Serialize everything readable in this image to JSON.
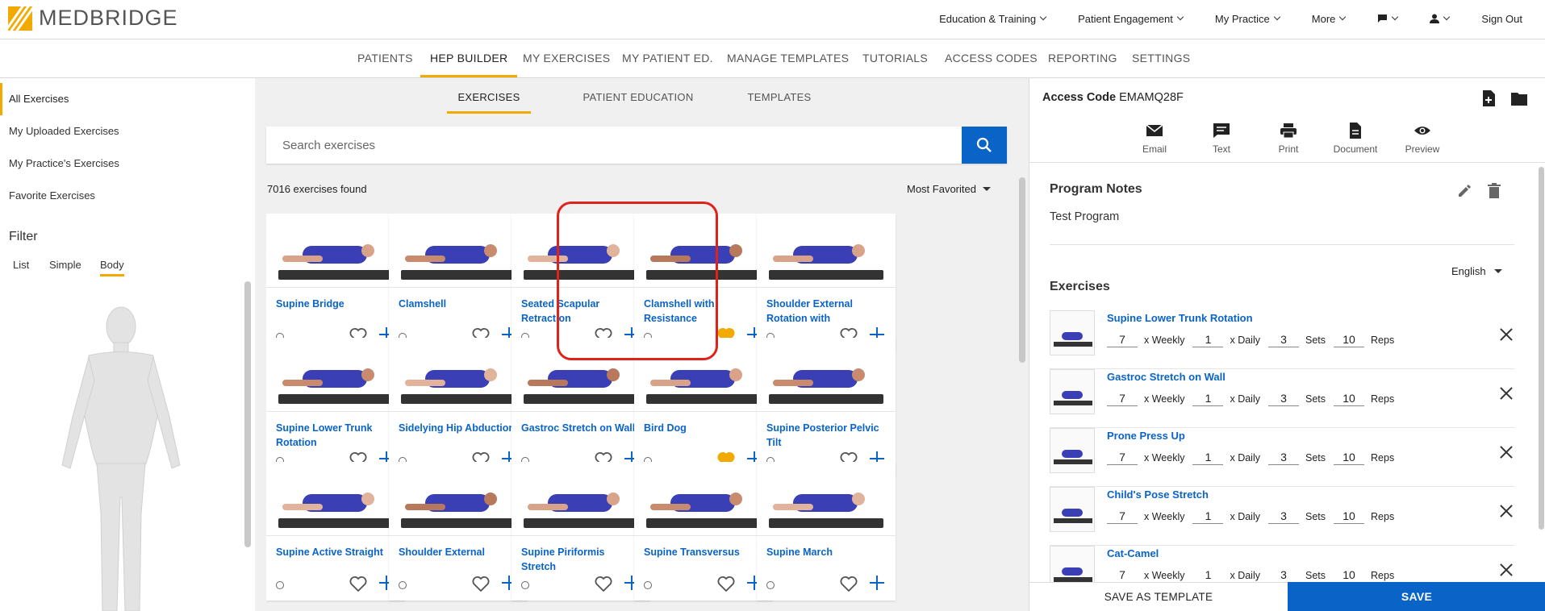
{
  "brand": {
    "name": "MEDBRIDGE",
    "accent": "#f2a900",
    "link": "#0a64c8"
  },
  "topnav": {
    "items": [
      "Education & Training",
      "Patient Engagement",
      "My Practice",
      "More"
    ],
    "sign_out": "Sign Out"
  },
  "subnav": {
    "items": [
      "PATIENTS",
      "HEP BUILDER",
      "MY EXERCISES",
      "MY PATIENT ED.",
      "MANAGE TEMPLATES",
      "TUTORIALS",
      "ACCESS CODES",
      "REPORTING",
      "SETTINGS"
    ],
    "active": "HEP BUILDER"
  },
  "sidebar": {
    "items": [
      "All Exercises",
      "My Uploaded Exercises",
      "My Practice's Exercises",
      "Favorite Exercises"
    ],
    "filter_title": "Filter",
    "filter_tabs": [
      "List",
      "Simple",
      "Body"
    ]
  },
  "middle": {
    "tabs": [
      "EXERCISES",
      "PATIENT EDUCATION",
      "TEMPLATES"
    ],
    "search_placeholder": "Search exercises",
    "count": "7016 exercises found",
    "sort": "Most Favorited",
    "cards": [
      {
        "title": "Supine Bridge",
        "favorited": false
      },
      {
        "title": "Clamshell",
        "favorited": false
      },
      {
        "title": "Seated Scapular Retraction",
        "favorited": false
      },
      {
        "title": "Clamshell with Resistance",
        "favorited": true
      },
      {
        "title": "Shoulder External Rotation with Anchored…",
        "favorited": false
      },
      {
        "title": "Supine Lower Trunk Rotation",
        "favorited": false
      },
      {
        "title": "Sidelying Hip Abduction",
        "favorited": false
      },
      {
        "title": "Gastroc Stretch on Wall",
        "favorited": false
      },
      {
        "title": "Bird Dog",
        "favorited": true
      },
      {
        "title": "Supine Posterior Pelvic Tilt",
        "favorited": false
      },
      {
        "title": "Supine Active Straight",
        "favorited": false
      },
      {
        "title": "Shoulder External",
        "favorited": false
      },
      {
        "title": "Supine Piriformis Stretch",
        "favorited": false
      },
      {
        "title": "Supine Transversus",
        "favorited": false
      },
      {
        "title": "Supine March",
        "favorited": false
      }
    ]
  },
  "right": {
    "access_label": "Access Code",
    "access_code": "EMAMQ28F",
    "share": [
      "Email",
      "Text",
      "Print",
      "Document",
      "Preview"
    ],
    "notes_title": "Program Notes",
    "notes_text": "Test Program",
    "language": "English",
    "exercises_title": "Exercises",
    "labels": {
      "weekly": "x Weekly",
      "daily": "x Daily",
      "sets": "Sets",
      "reps": "Reps"
    },
    "exercises": [
      {
        "name": "Supine Lower Trunk Rotation",
        "weekly": "7",
        "daily": "1",
        "sets": "3",
        "reps": "10"
      },
      {
        "name": "Gastroc Stretch on Wall",
        "weekly": "7",
        "daily": "1",
        "sets": "3",
        "reps": "10"
      },
      {
        "name": "Prone Press Up",
        "weekly": "7",
        "daily": "1",
        "sets": "3",
        "reps": "10"
      },
      {
        "name": "Child's Pose Stretch",
        "weekly": "7",
        "daily": "1",
        "sets": "3",
        "reps": "10"
      },
      {
        "name": "Cat-Camel",
        "weekly": "7",
        "daily": "1",
        "sets": "3",
        "reps": "10"
      }
    ],
    "save_template": "SAVE AS TEMPLATE",
    "save": "SAVE"
  }
}
